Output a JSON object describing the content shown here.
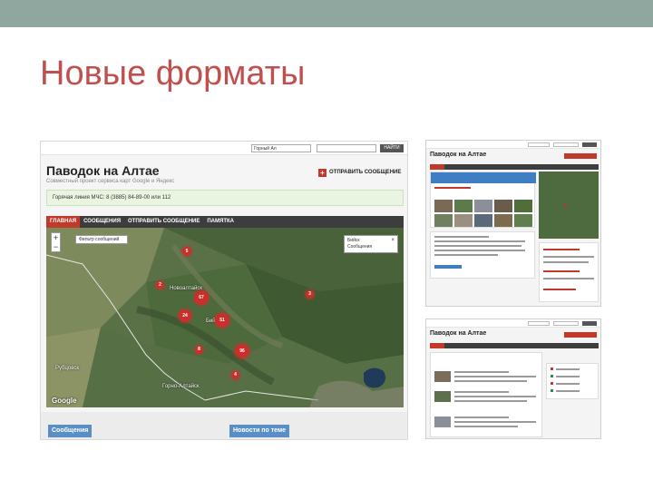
{
  "slide": {
    "title": "Новые форматы",
    "topbar_color": "#8fa79f",
    "title_color": "#c0504d"
  },
  "main_screenshot": {
    "top": {
      "region_select": "Горный Ал",
      "find_button": "НАЙТИ"
    },
    "page_title": "Паводок на Алтае",
    "subtitle": "Совместный проект сервиса карт Google и Яндекс",
    "send_message_button": "ОТПРАВИТЬ СООБЩЕНИЕ",
    "hotline": "Горячая линия МЧС: 8 (3885) 84-89-00 или 112",
    "nav_tabs": [
      {
        "label": "ГЛАВНАЯ",
        "active": true
      },
      {
        "label": "СООБЩЕНИЯ",
        "active": false
      },
      {
        "label": "ОТПРАВИТЬ СООБЩЕНИЕ",
        "active": false
      },
      {
        "label": "ПАМЯТКА",
        "active": false
      }
    ],
    "map": {
      "zoom_in": "+",
      "zoom_out": "−",
      "search_placeholder": "Фильтр сообщений",
      "popup_line1": "Бийск",
      "popup_line2": "Сообщения",
      "close_symbol": "×",
      "labels": [
        "Новоалтайск",
        "Бийск",
        "Рубцовск",
        "Горно-Алтайск"
      ],
      "attribution": "Google",
      "markers": [
        "5",
        "2",
        "67",
        "24",
        "51",
        "8",
        "96",
        "4",
        "3"
      ]
    },
    "bottom_buttons": {
      "messages": "Сообщения",
      "news": "Новости по теме"
    },
    "colors": {
      "accent_red": "#c0392b",
      "nav_dark": "#3d3d3d",
      "hotline_bg": "#e9f5e1",
      "button_blue": "#5a8fc6"
    }
  },
  "thumbnails": [
    {
      "title": "Паводок на Алтае"
    },
    {
      "title": "Паводок на Алтае"
    }
  ]
}
